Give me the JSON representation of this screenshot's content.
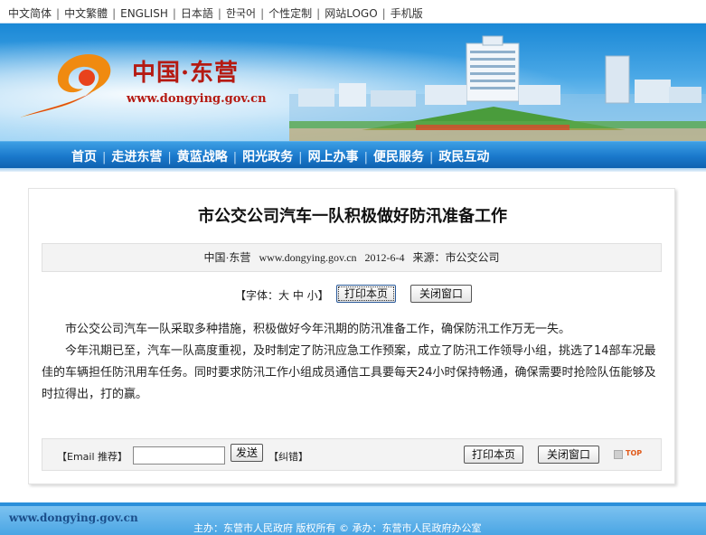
{
  "langbar": {
    "links": [
      "中文简体",
      "中文繁體",
      "ENGLISH",
      "日本語",
      "한국어",
      "个性定制",
      "网站LOGO",
      "手机版"
    ],
    "separator": "|"
  },
  "banner": {
    "site_name": "中国·东营",
    "site_url": "www.dongying.gov.cn",
    "logo_icon": "dongying-swirl-logo-icon"
  },
  "nav": {
    "items": [
      "首页",
      "走进东营",
      "黄蓝战略",
      "阳光政务",
      "网上办事",
      "便民服务",
      "政民互动"
    ],
    "separator": "|"
  },
  "article": {
    "title": "市公交公司汽车一队积极做好防汛准备工作",
    "meta": {
      "site": "中国·东营",
      "url": "www.dongying.gov.cn",
      "date": "2012-6-4",
      "source": "来源：市公交公司"
    },
    "font_size_label": "【字体：大 中 小】",
    "print_button": "打印本页",
    "close_button": "关闭窗口",
    "paragraphs": [
      "市公交公司汽车一队采取多种措施，积极做好今年汛期的防汛准备工作，确保防汛工作万无一失。",
      "今年汛期已至，汽车一队高度重视，及时制定了防汛应急工作预案，成立了防汛工作领导小组，挑选了14部车况最佳的车辆担任防汛用车任务。同时要求防汛工作小组成员通信工具要每天24小时保持畅通，确保需要时抢险队伍能够及时拉得出，打的赢。"
    ]
  },
  "share": {
    "email_label": "【Email 推荐】",
    "email_value": "",
    "send_button": "发送",
    "report_label": "【纠错】",
    "print_button": "打印本页",
    "close_button": "关闭窗口",
    "top_label": "TOP"
  },
  "footer": {
    "url": "www.dongying.gov.cn",
    "copyright": "主办：东营市人民政府  版权所有  ©  承办：东营市人民政府办公室"
  },
  "colors": {
    "brand_red": "#b51a12",
    "nav_blue": "#1a79cc",
    "banner_blue": "#1a88d6"
  }
}
